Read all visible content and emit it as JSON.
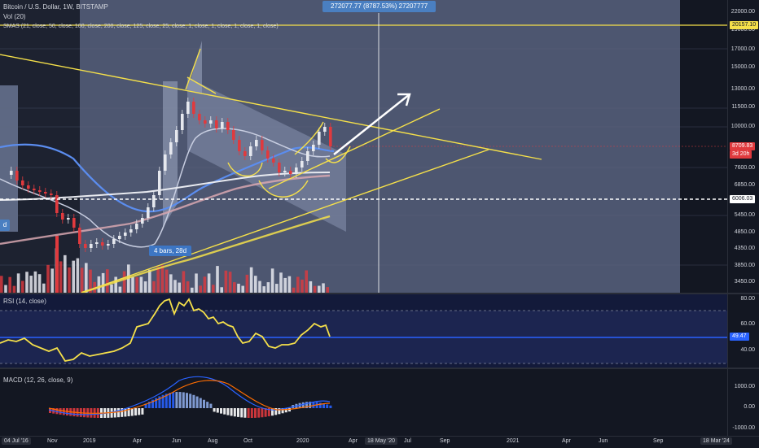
{
  "header": {
    "title": "Bitcoin / U.S. Dollar, 1W, BITSTAMP",
    "vol": "Vol (20)",
    "smas": "SMAS (21, close, 50, close, 100, close, 200, close, 125, close, 25, close, 1, close, 1, close, 1, close, 1, close)"
  },
  "measure_label": "272077.77 (8787.53%) 27207777",
  "bars_label": "4 bars, 28d",
  "price_scale": [
    "22000.00",
    "19000.00",
    "17000.00",
    "15000.00",
    "13000.00",
    "11500.00",
    "10000.00",
    "7600.00",
    "6850.00",
    "5450.00",
    "4850.00",
    "4350.00",
    "3850.00",
    "3450.00"
  ],
  "price_labels": {
    "top_line": "20157.10",
    "current": "8709.83",
    "countdown": "3d 20h",
    "dashed": "6006.03"
  },
  "rsi": {
    "legend": "RSI (14, close)",
    "ticks": [
      "80.00",
      "60.00",
      "40.00"
    ],
    "value": "49.47"
  },
  "macd": {
    "legend": "MACD (12, 26, close, 9)",
    "ticks": [
      "1000.00",
      "0.00",
      "-1000.00"
    ]
  },
  "left_label": "d",
  "time_axis": {
    "start_box": "04 Jul '16",
    "labels": [
      "Nov",
      "2019",
      "Apr",
      "Jun",
      "Aug",
      "Oct",
      "2020",
      "Apr",
      "Jul",
      "Sep",
      "2021",
      "Apr",
      "Jun",
      "Sep"
    ],
    "cursor_box": "18 May '20",
    "end_box": "18 Mar '24"
  },
  "colors": {
    "background": "#131722",
    "up_candle": "#e6e8ee",
    "down_candle": "#e03a3e",
    "trendline": "#f5e04a",
    "rsi_line": "#f5e04a",
    "rsi_mid": "#2962ff",
    "macd_line": "#2962ff",
    "signal_line": "#ff6d00"
  }
}
